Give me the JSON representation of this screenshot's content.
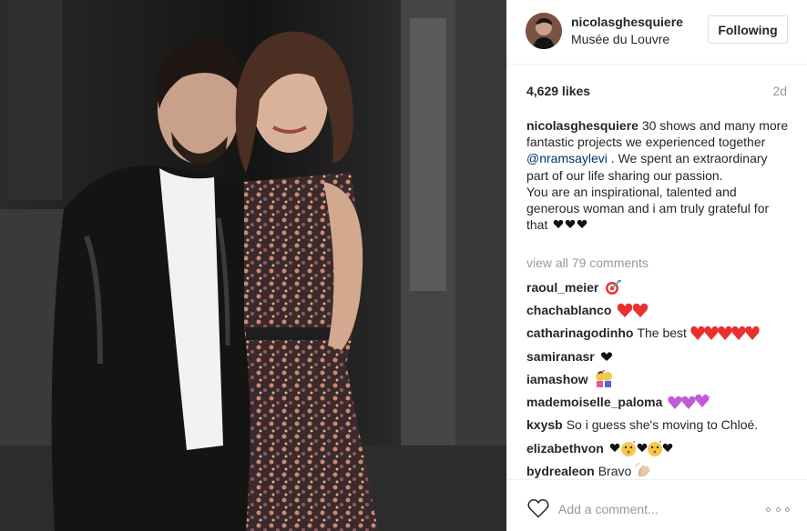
{
  "post": {
    "username": "nicolasghesquiere",
    "location": "Musée du Louvre",
    "follow_label": "Following",
    "likes": "4,629 likes",
    "age": "2d",
    "caption": {
      "username": "nicolasghesquiere",
      "text_before_mention": " 30 shows and many more fantastic projects we experienced together ",
      "mention": "@nramsaylevi",
      "text_after_mention": " . We spent an extraordinary part of our life sharing our passion.",
      "second_paragraph": "You are an inspirational, talented and generous woman and i am truly grateful for that "
    },
    "view_all_comments": "view all 79 comments",
    "comments": [
      {
        "user": "raoul_meier",
        "text": "",
        "emoji": "target"
      },
      {
        "user": "chachablanco",
        "text": "",
        "emoji": "red-hearts-2"
      },
      {
        "user": "catharinagodinho",
        "text": "The best",
        "emoji": "red-hearts-5"
      },
      {
        "user": "samiranasr",
        "text": "",
        "emoji": "black-heart"
      },
      {
        "user": "iamashow",
        "text": "",
        "emoji": "kissing-couple"
      },
      {
        "user": "mademoiselle_paloma",
        "text": "",
        "emoji": "purple-hearts-3"
      },
      {
        "user": "kxysb",
        "text": "So i guess she's moving to Chloé.",
        "emoji": ""
      },
      {
        "user": "elizabethvon",
        "text": "",
        "emoji": "kiss-faces-hearts"
      },
      {
        "user": "bydrealeon",
        "text": "Bravo",
        "emoji": "clapping-hands"
      }
    ],
    "add_comment_placeholder": "Add a comment..."
  },
  "icons": {
    "like": "heart-outline-icon",
    "more": "more-options-icon"
  },
  "colors": {
    "text": "#262626",
    "muted": "#999999",
    "mention": "#003569",
    "border": "#efefef",
    "heart_red": "#e8302f"
  }
}
